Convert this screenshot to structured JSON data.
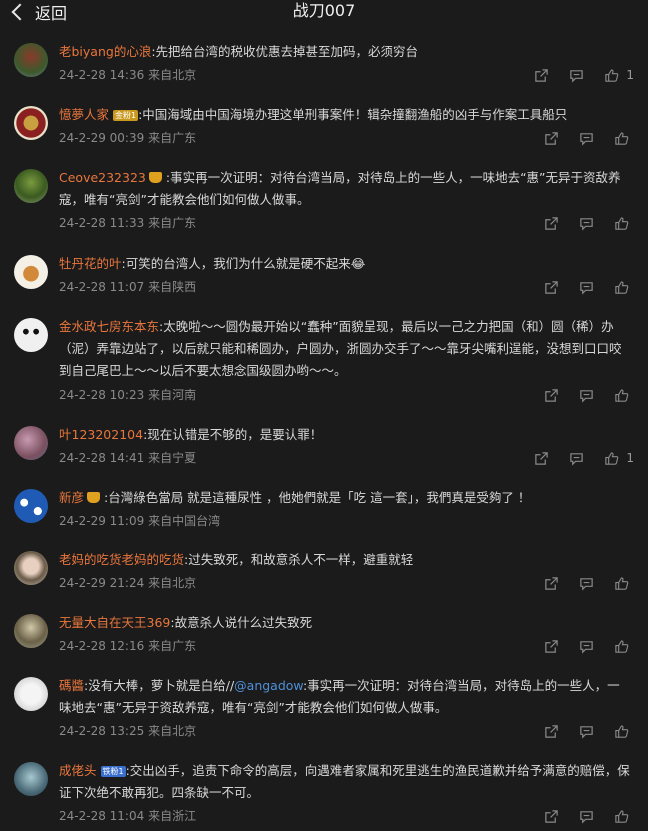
{
  "header": {
    "back_label": "返回",
    "title": "战刀007"
  },
  "colors": {
    "background": "#1b1b1b",
    "username": "#e9763c",
    "mention": "#4f8fd8",
    "meta": "#8a8a8a"
  },
  "comments": [
    {
      "user": "老biyang的心浪",
      "text": ":先把给台湾的税收优惠去掉甚至加码，必须穷台",
      "time": "24-2-28 14:36",
      "location": "来自北京",
      "likes": "1",
      "avatar_icon": "pagoda-avatar"
    },
    {
      "user": "憶夢人家",
      "badge": "金粉1",
      "text": ":中国海域由中国海境办理这单刑事案件！辑杂撞翻渔船的凶手与作案工具船只",
      "time": "24-2-29 00:39",
      "location": "来自广东",
      "likes": "",
      "avatar_icon": "emblem-avatar"
    },
    {
      "user": "Ceove232323",
      "crown": true,
      "text": ":事实再一次证明：对待台湾当局，对待岛上的一些人，一味地去“惠”无异于资敌养寇，唯有“亮剑”才能教会他们如何做人做事。",
      "time": "24-2-28 11:33",
      "location": "来自广东",
      "likes": "",
      "avatar_icon": "tree-avatar"
    },
    {
      "user": "牡丹花的叶",
      "text": ":可笑的台湾人，我们为什么就是硬不起来😂",
      "time": "24-2-28 11:07",
      "location": "来自陕西",
      "likes": "",
      "avatar_icon": "cartoon-avatar"
    },
    {
      "user": "金水政七房东本东",
      "text": ":太晚啦～～圆伪最开始以“蠢种”面貌呈现，最后以一己之力把国（和）圆（稀）办（泥）弄靠边站了，以后就只能和稀圆办，户圆办，浙圆办交手了～～靠牙尖嘴利逞能，没想到口口咬到自己尾巴上～～以后不要太想念国级圆办哟～～。",
      "time": "24-2-28 10:23",
      "location": "来自河南",
      "likes": "",
      "avatar_icon": "panda-avatar"
    },
    {
      "user": "叶123202104",
      "text": ":现在认错是不够的，是要认罪！",
      "time": "24-2-28 14:41",
      "location": "来自宁夏",
      "likes": "1",
      "avatar_icon": "flower-avatar"
    },
    {
      "user": "新彦",
      "crown": true,
      "text": ":台灣綠色當局 就是這種尿性 ，他她們就是「吃 這一套」，我們真是受夠了 ！",
      "time": "24-2-29 11:09",
      "location": "来自中国台湾",
      "likes": "",
      "avatar_icon": "hai-avatar"
    },
    {
      "user": "老妈的吃货老妈的吃货",
      "text": ":过失致死，和故意杀人不一样，避重就轻",
      "time": "24-2-29 21:24",
      "location": "来自北京",
      "likes": "",
      "avatar_icon": "doll-avatar"
    },
    {
      "user": "无量大自在天王369",
      "text": ":故意杀人说什么过失致死",
      "time": "24-2-28 12:16",
      "location": "来自广东",
      "likes": "",
      "avatar_icon": "figure-avatar"
    },
    {
      "user": "碼醬",
      "text": ":没有大棒，萝卜就是白给//",
      "mention": "@angadow",
      "text2": ":事实再一次证明：对待台湾当局，对待岛上的一些人，一味地去“惠”无异于资敌养寇，唯有“亮剑”才能教会他们如何做人做事。",
      "time": "24-2-28 13:25",
      "location": "来自北京",
      "likes": "",
      "avatar_icon": "sketch-avatar"
    },
    {
      "user": "成佬头",
      "badge": "铁粉1",
      "text": ":交出凶手，追责下命令的高层，向遇难者家属和死里逃生的渔民道歉并给予满意的赔偿，保证下次绝不敢再犯。四条缺一不可。",
      "time": "24-2-28 11:04",
      "location": "来自浙江",
      "likes": "",
      "avatar_icon": "bird-avatar"
    }
  ]
}
